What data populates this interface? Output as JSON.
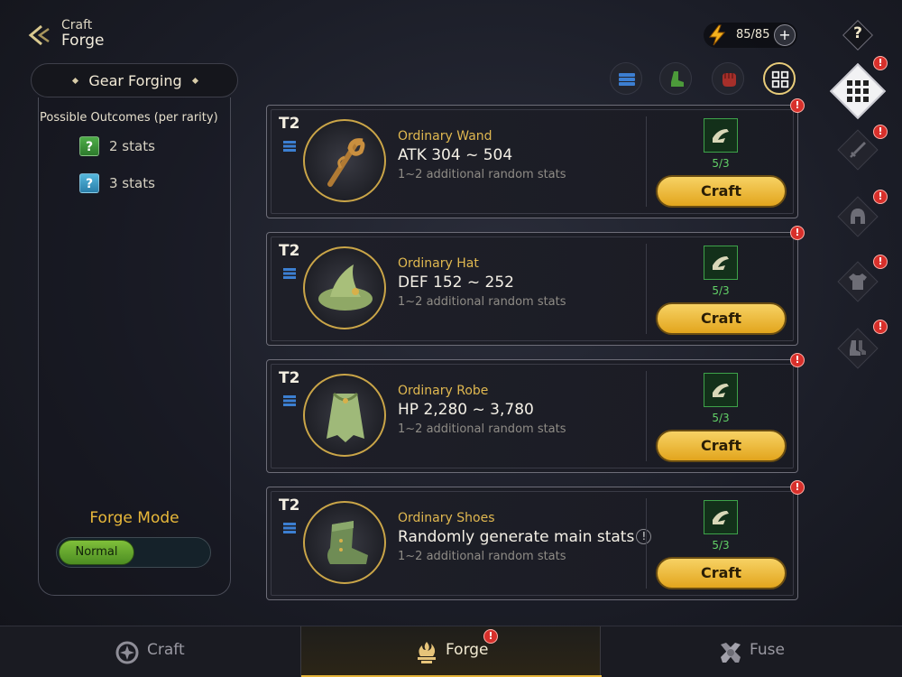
{
  "header": {
    "breadcrumb_parent": "Craft",
    "breadcrumb_title": "Forge",
    "energy": "85/85",
    "energy_add": "+",
    "help": "?"
  },
  "left_panel": {
    "title": "Gear Forging",
    "outcomes_title": "Possible Outcomes (per rarity)",
    "outcomes": [
      {
        "badge": "?",
        "label": "2 stats",
        "color": "#3f9a3c"
      },
      {
        "badge": "?",
        "label": "3 stats",
        "color": "#3fa0cc"
      }
    ],
    "forge_mode_title": "Forge Mode",
    "forge_mode_value": "Normal"
  },
  "filters": [
    "layers-icon",
    "boot-icon",
    "fist-icon",
    "grid-icon"
  ],
  "items": [
    {
      "tier": "T2",
      "name": "Ordinary Wand",
      "stat": "ATK 304 ~ 504",
      "extra": "1~2 additional random stats",
      "materials": "5/3",
      "craft_label": "Craft",
      "icon": "wand-icon",
      "alert": "!"
    },
    {
      "tier": "T2",
      "name": "Ordinary Hat",
      "stat": "DEF 152 ~ 252",
      "extra": "1~2 additional random stats",
      "materials": "5/3",
      "craft_label": "Craft",
      "icon": "hat-icon",
      "alert": "!"
    },
    {
      "tier": "T2",
      "name": "Ordinary Robe",
      "stat": "HP 2,280 ~ 3,780",
      "extra": "1~2 additional random stats",
      "materials": "5/3",
      "craft_label": "Craft",
      "icon": "robe-icon",
      "alert": "!"
    },
    {
      "tier": "T2",
      "name": "Ordinary Shoes",
      "stat": "Randomly generate main stats",
      "stat_info": "!",
      "extra": "1~2 additional random stats",
      "materials": "5/3",
      "craft_label": "Craft",
      "icon": "shoes-icon",
      "alert": "!"
    }
  ],
  "categories": [
    {
      "name": "all",
      "icon": "grid-icon",
      "alert": "!"
    },
    {
      "name": "weapon",
      "icon": "sword-icon",
      "alert": "!"
    },
    {
      "name": "helmet",
      "icon": "helmet-icon",
      "alert": "!"
    },
    {
      "name": "armor",
      "icon": "armor-icon",
      "alert": "!"
    },
    {
      "name": "boots",
      "icon": "boots-icon",
      "alert": "!"
    }
  ],
  "tabs": [
    {
      "label": "Craft",
      "icon": "craft-icon",
      "active": false
    },
    {
      "label": "Forge",
      "icon": "forge-icon",
      "active": true,
      "alert": "!"
    },
    {
      "label": "Fuse",
      "icon": "fuse-icon",
      "active": false
    }
  ],
  "colors": {
    "accent": "#e5b43a",
    "alert": "#d8302b",
    "material_green": "#62d267"
  }
}
